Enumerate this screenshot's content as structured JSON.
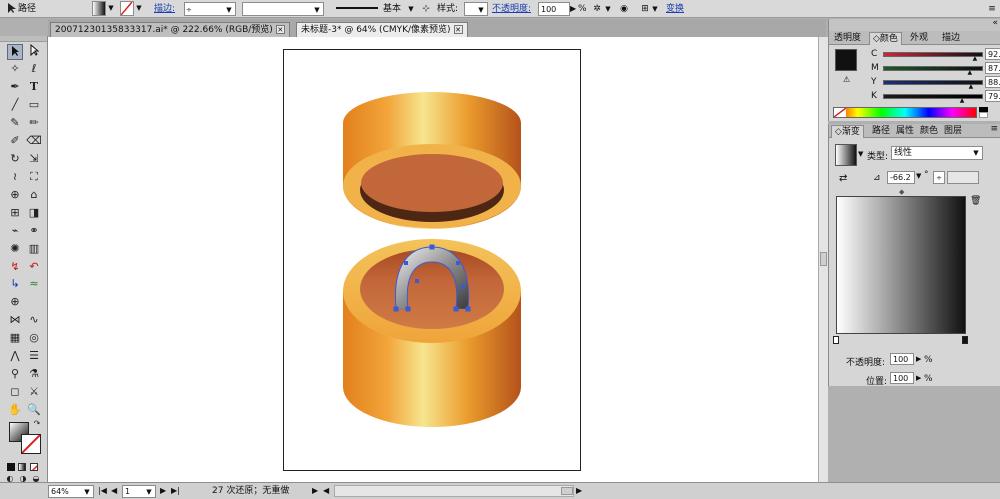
{
  "control_bar": {
    "object_type": "路径",
    "stroke_label": "描边:",
    "stroke_profile": "基本",
    "style_label": "样式:",
    "opacity_label": "不透明度:",
    "opacity_value": "100",
    "opacity_unit": "%",
    "transform_label": "变换"
  },
  "document_tabs": [
    {
      "label": "20071230135833317.ai* @ 222.66% (RGB/预览)",
      "active": false
    },
    {
      "label": "未标题-3* @ 64% (CMYK/像素预览)",
      "active": true
    }
  ],
  "color_panel": {
    "tabs": [
      "透明度",
      "颜色",
      "外观",
      "描边"
    ],
    "active_tab": "颜色",
    "channels": [
      {
        "label": "C",
        "value": "92.58",
        "level": 0.9258
      },
      {
        "label": "M",
        "value": "87.5",
        "level": 0.875
      },
      {
        "label": "Y",
        "value": "88.67",
        "level": 0.8867
      },
      {
        "label": "K",
        "value": "79.69",
        "level": 0.7969
      }
    ]
  },
  "gradient_panel": {
    "tabs": [
      "渐变",
      "路径",
      "属性",
      "颜色",
      "图层"
    ],
    "active_tab": "渐变",
    "type_label": "类型:",
    "type_value": "线性",
    "angle_value": "-66.2",
    "angle_unit": "°",
    "opacity_label": "不透明度:",
    "opacity_value": "100",
    "location_label": "位置:",
    "location_value": "100",
    "percent": "%"
  },
  "status_bar": {
    "zoom": "64%",
    "page": "1",
    "undo_text": "27 次还原；无重做"
  },
  "colors": {
    "orange_light": "#f2e28a",
    "orange_mid": "#e99a2c",
    "orange_dark": "#b9591c",
    "inner_brown": "#c2673a",
    "selection_blue": "#3b5bd6"
  },
  "icons": {
    "selection": "selection-arrow-icon",
    "direct_select": "direct-select-icon",
    "pen": "pen-icon",
    "type": "type-icon",
    "zoom": "zoom-icon",
    "hand": "hand-icon",
    "trash": "trash-icon"
  }
}
